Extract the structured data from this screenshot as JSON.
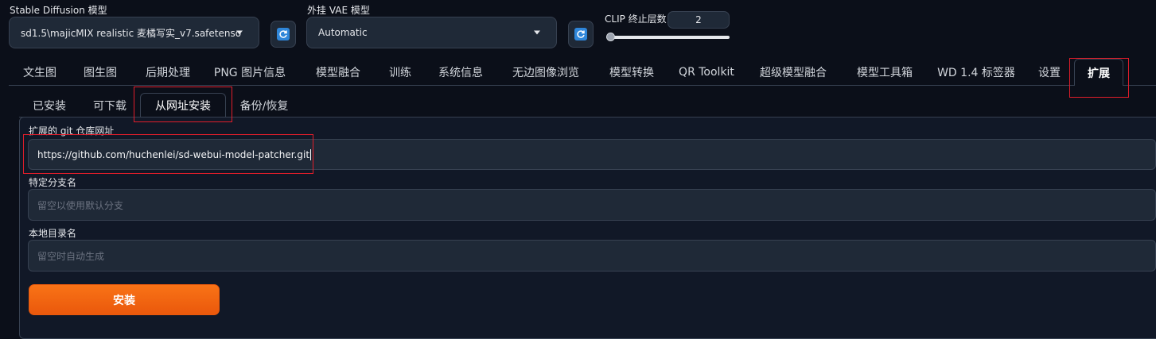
{
  "top": {
    "model_label": "Stable Diffusion 模型",
    "model_value": "sd1.5\\majicMIX realistic 麦橘写实_v7.safetenso",
    "vae_label": "外挂 VAE 模型",
    "vae_value": "Automatic",
    "clip_label": "CLIP 终止层数",
    "clip_value": "2",
    "clip_slider_fraction": 0.0
  },
  "tabs": [
    "文生图",
    "图生图",
    "后期处理",
    "PNG 图片信息",
    "模型融合",
    "训练",
    "系统信息",
    "无边图像浏览",
    "模型转换",
    "QR Toolkit",
    "超级模型融合",
    "模型工具箱",
    "WD 1.4 标签器",
    "设置",
    "扩展"
  ],
  "active_tab": "扩展",
  "subtabs": [
    "已安装",
    "可下载",
    "从网址安装",
    "备份/恢复"
  ],
  "active_subtab": "从网址安装",
  "form": {
    "git_label": "扩展的 git 仓库网址",
    "git_value": "https://github.com/huchenlei/sd-webui-model-patcher.git",
    "branch_label": "特定分支名",
    "branch_placeholder": "留空以使用默认分支",
    "dir_label": "本地目录名",
    "dir_placeholder": "留空时自动生成",
    "install_label": "安装"
  },
  "colors": {
    "accent": "#ea580c",
    "highlight": "#e11d2a",
    "background": "#0b0f19"
  }
}
